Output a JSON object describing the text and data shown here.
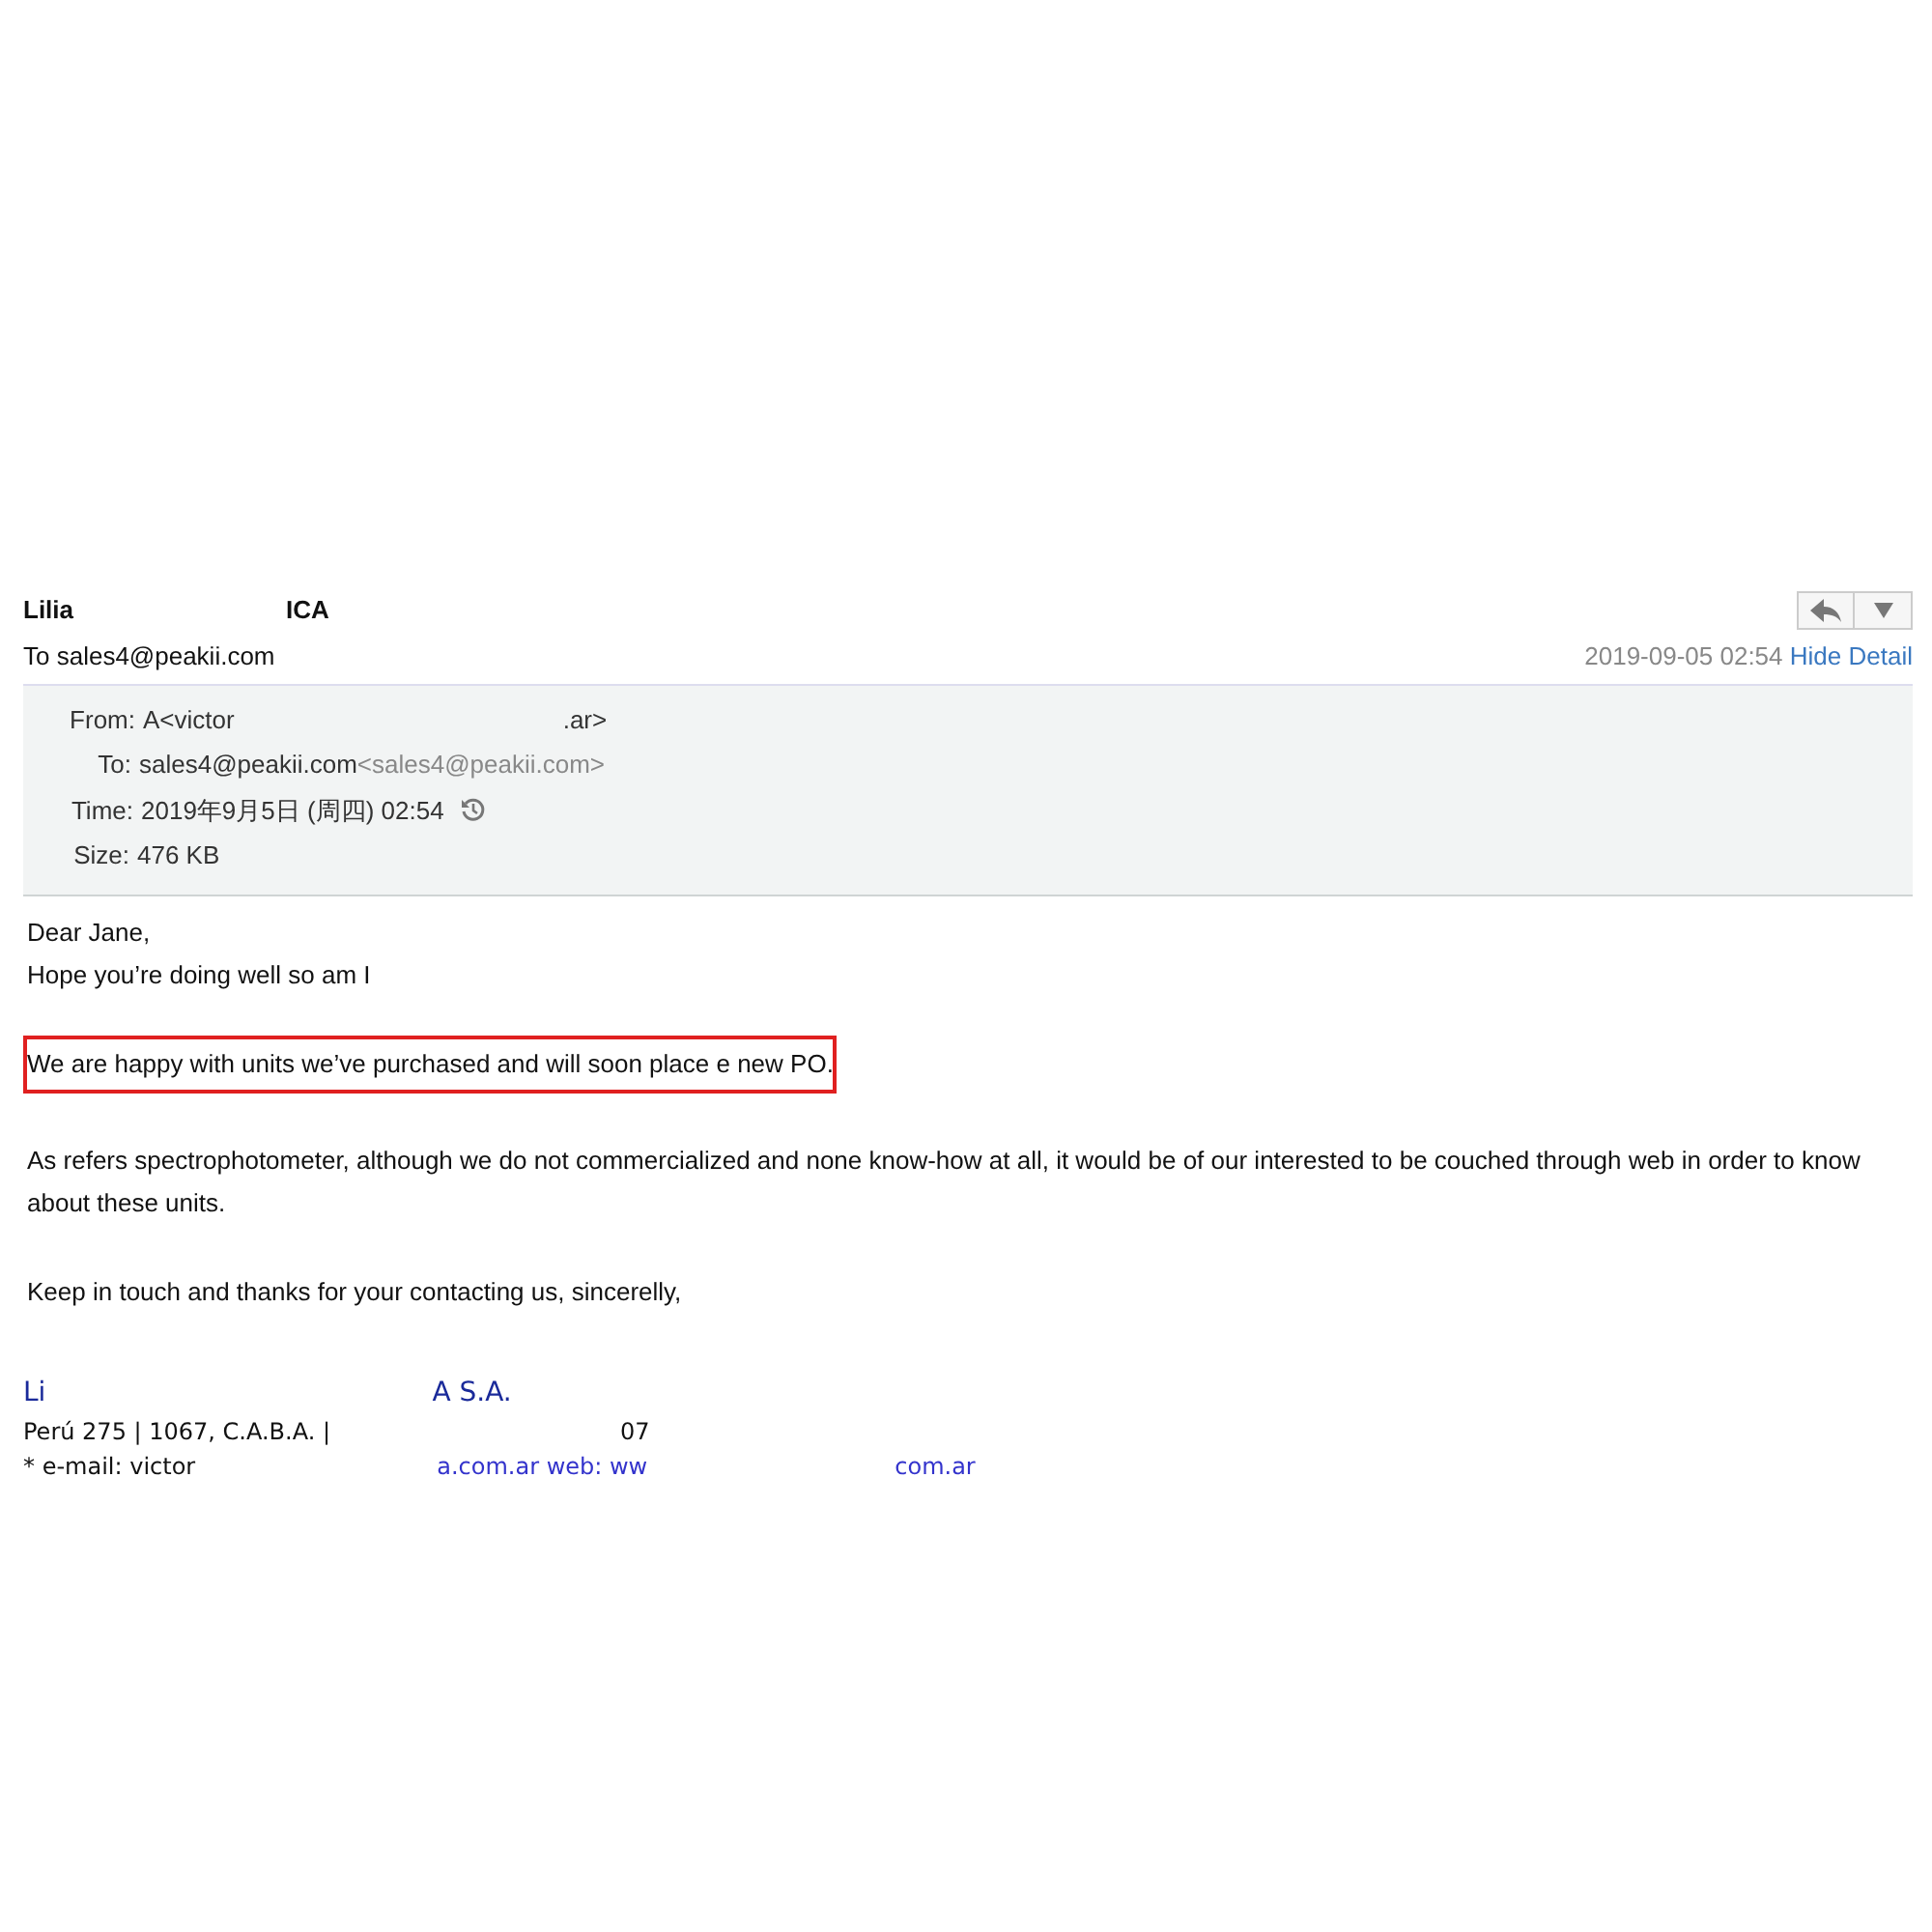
{
  "header": {
    "sender_parts": [
      "Lilia",
      "ICA"
    ],
    "to": "To sales4@peakii.com",
    "date": "2019-09-05 02:54",
    "toggle": "Hide Detail"
  },
  "details": [
    {
      "kind": "from",
      "label": "From:",
      "parts": [
        "A<victor",
        ".ar>"
      ]
    },
    {
      "kind": "to",
      "label": "To:",
      "parts": [
        "sales4@peakii.com"
      ],
      "extra": "<sales4@peakii.com>"
    },
    {
      "kind": "time",
      "label": "Time:",
      "parts": [
        "2019年9月5日 (周四) 02:54"
      ]
    },
    {
      "kind": "size",
      "label": "Size:",
      "parts": [
        "476 KB"
      ]
    }
  ],
  "body": [
    {
      "lines": [
        "Dear Jane,",
        "Hope you’re doing well so am I"
      ],
      "highlighted": false
    },
    {
      "lines": [
        "We are happy with units we’ve purchased and will soon place e new PO."
      ],
      "highlighted": true
    },
    {
      "lines": [
        "As refers spectrophotometer, although we do not commercialized and none know-how at all, it would be of our interested to be couched  through web in order to know about these units."
      ],
      "highlighted": false
    },
    {
      "lines": [
        "Keep in touch and thanks for your contacting us, sincerelly,"
      ],
      "highlighted": false
    }
  ],
  "signature": [
    {
      "kind": "name",
      "parts": [
        "Li",
        "A S.A."
      ]
    },
    {
      "kind": "address",
      "parts": [
        "Perú 275 | 1067, C.A.B.A. |",
        "07"
      ]
    },
    {
      "kind": "contact",
      "parts": [
        "* e-mail: victor",
        "a.com.ar web: ww",
        "com.ar"
      ]
    }
  ]
}
